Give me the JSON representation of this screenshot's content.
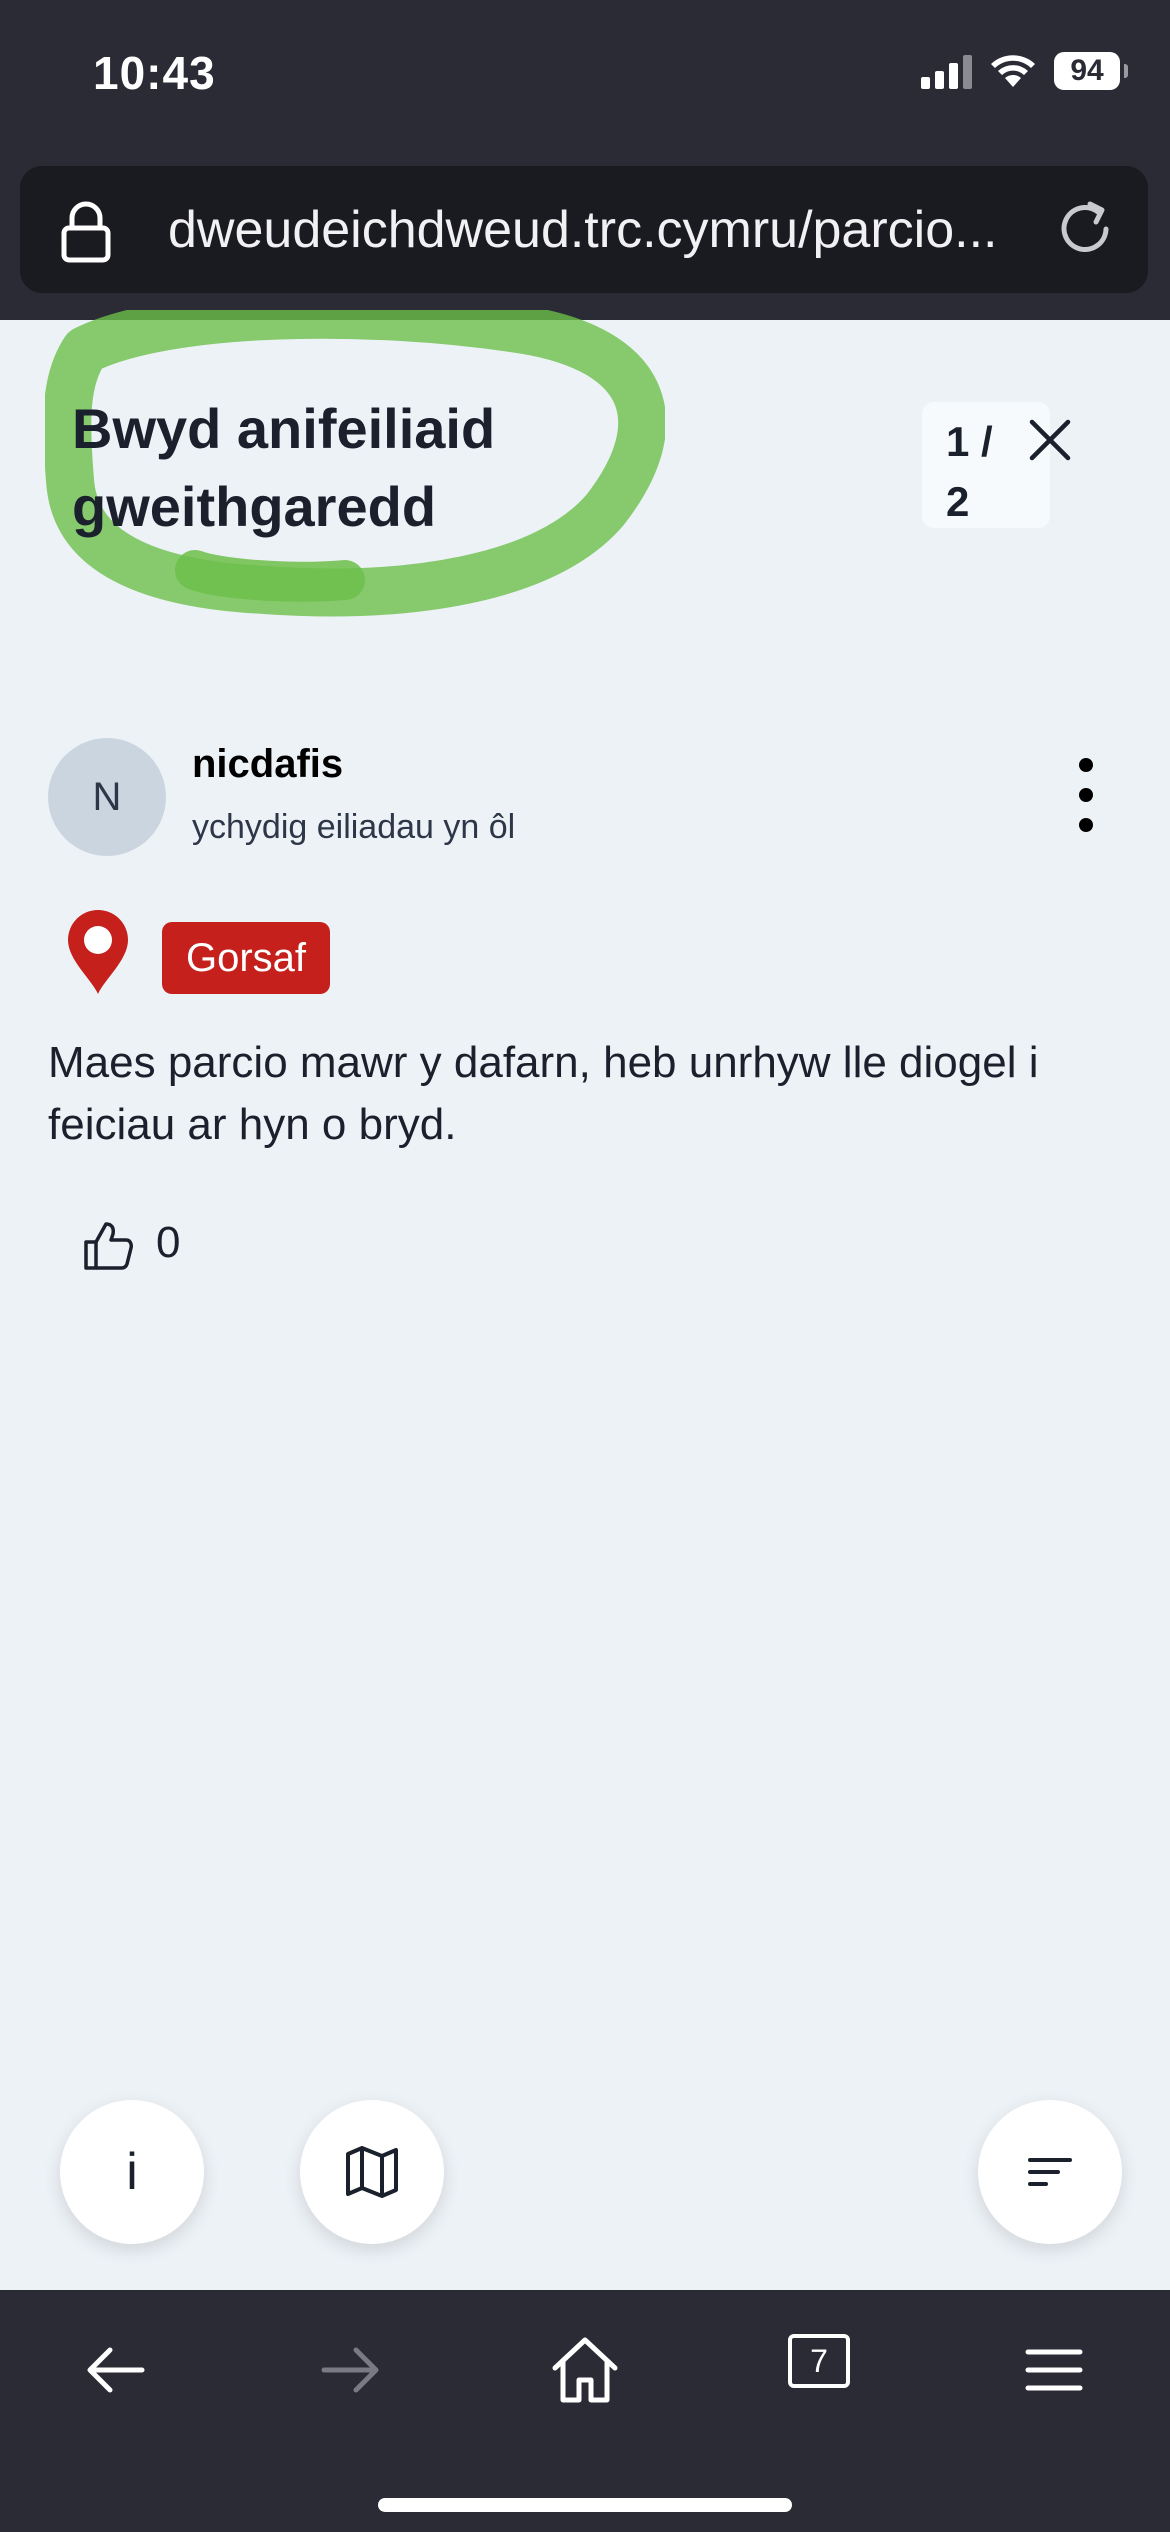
{
  "status_bar": {
    "time": "10:43",
    "battery": "94",
    "icons": [
      "signal-icon",
      "wifi-icon",
      "battery-icon"
    ]
  },
  "browser": {
    "url": "dweudeichdweud.trc.cymru/parcio...",
    "tabs_count": "7",
    "icons": [
      "lock-icon",
      "reload-icon",
      "back-arrow-icon",
      "forward-arrow-icon",
      "home-icon",
      "tabs-icon",
      "menu-icon"
    ]
  },
  "post": {
    "title": "Bwyd anifeiliaid gweithgaredd",
    "pager": "1 / 2",
    "avatar_initial": "N",
    "username": "nicdafis",
    "timestamp": "ychydig eiliadau yn ôl",
    "category": "Gorsaf",
    "body": "Maes parcio mawr y dafarn, heb unrhyw lle diogel i feiciau ar hyn o bryd.",
    "likes": "0"
  },
  "fabs": {
    "info_label": "i"
  },
  "colors": {
    "page_bg": "#edf2f7",
    "chrome_bg": "#2b2b36",
    "badge_red": "#c5201c",
    "highlight_green": "#6cbf4a"
  }
}
